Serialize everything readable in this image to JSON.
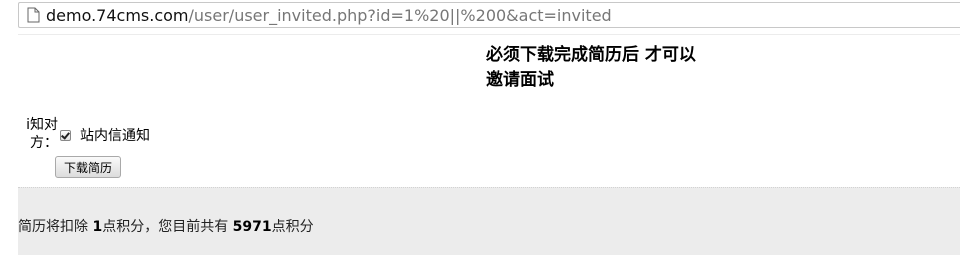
{
  "browser": {
    "url_domain": "demo.74cms.com",
    "url_path": "/user/user_invited.php?id=1%20||%200&act=invited",
    "page_icon": "page-icon"
  },
  "notice": {
    "line1": "必须下载完成简历后 才可以",
    "line2": "邀请面试"
  },
  "form": {
    "notify_label_line1": "i知对",
    "notify_label_line2": "方：",
    "site_message_label": "站内信通知",
    "site_message_checked": true,
    "download_button": "下载简历"
  },
  "points": {
    "prefix": "简历将扣除 ",
    "deduct": "1",
    "middle": "点积分，您目前共有 ",
    "total": "5971",
    "suffix": "点积分"
  }
}
